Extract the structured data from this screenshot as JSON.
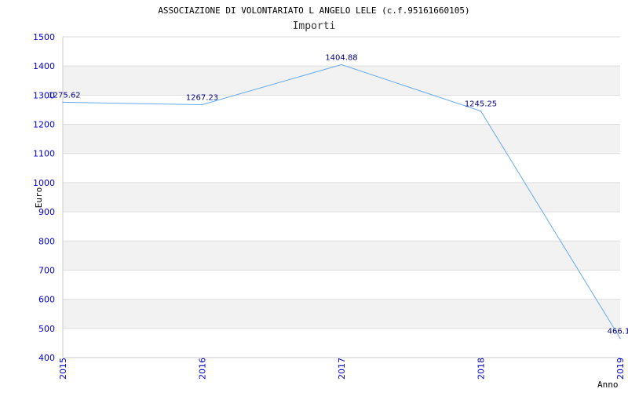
{
  "chart_data": {
    "type": "line",
    "title": "ASSOCIAZIONE DI VOLONTARIATO L ANGELO LELE (c.f.95161660105)",
    "subtitle": "Importi",
    "xlabel": "Anno",
    "ylabel": "Euro",
    "x": [
      "2015",
      "2016",
      "2017",
      "2018",
      "2019"
    ],
    "series": [
      {
        "values": [
          1275.62,
          1267.23,
          1404.88,
          1245.25,
          466.1
        ]
      }
    ],
    "data_labels": [
      "1275.62",
      "1267.23",
      "1404.88",
      "1245.25",
      "466.1"
    ],
    "ylim": [
      400,
      1500
    ],
    "yticks": [
      "400",
      "500",
      "600",
      "700",
      "800",
      "900",
      "1000",
      "1100",
      "1200",
      "1300",
      "1400",
      "1500"
    ],
    "grid": true,
    "colors": {
      "line": "#66aaee",
      "tick_text": "#0000cc",
      "label_text": "#000080",
      "band": "#f2f2f2",
      "grid": "#dddddd"
    }
  }
}
